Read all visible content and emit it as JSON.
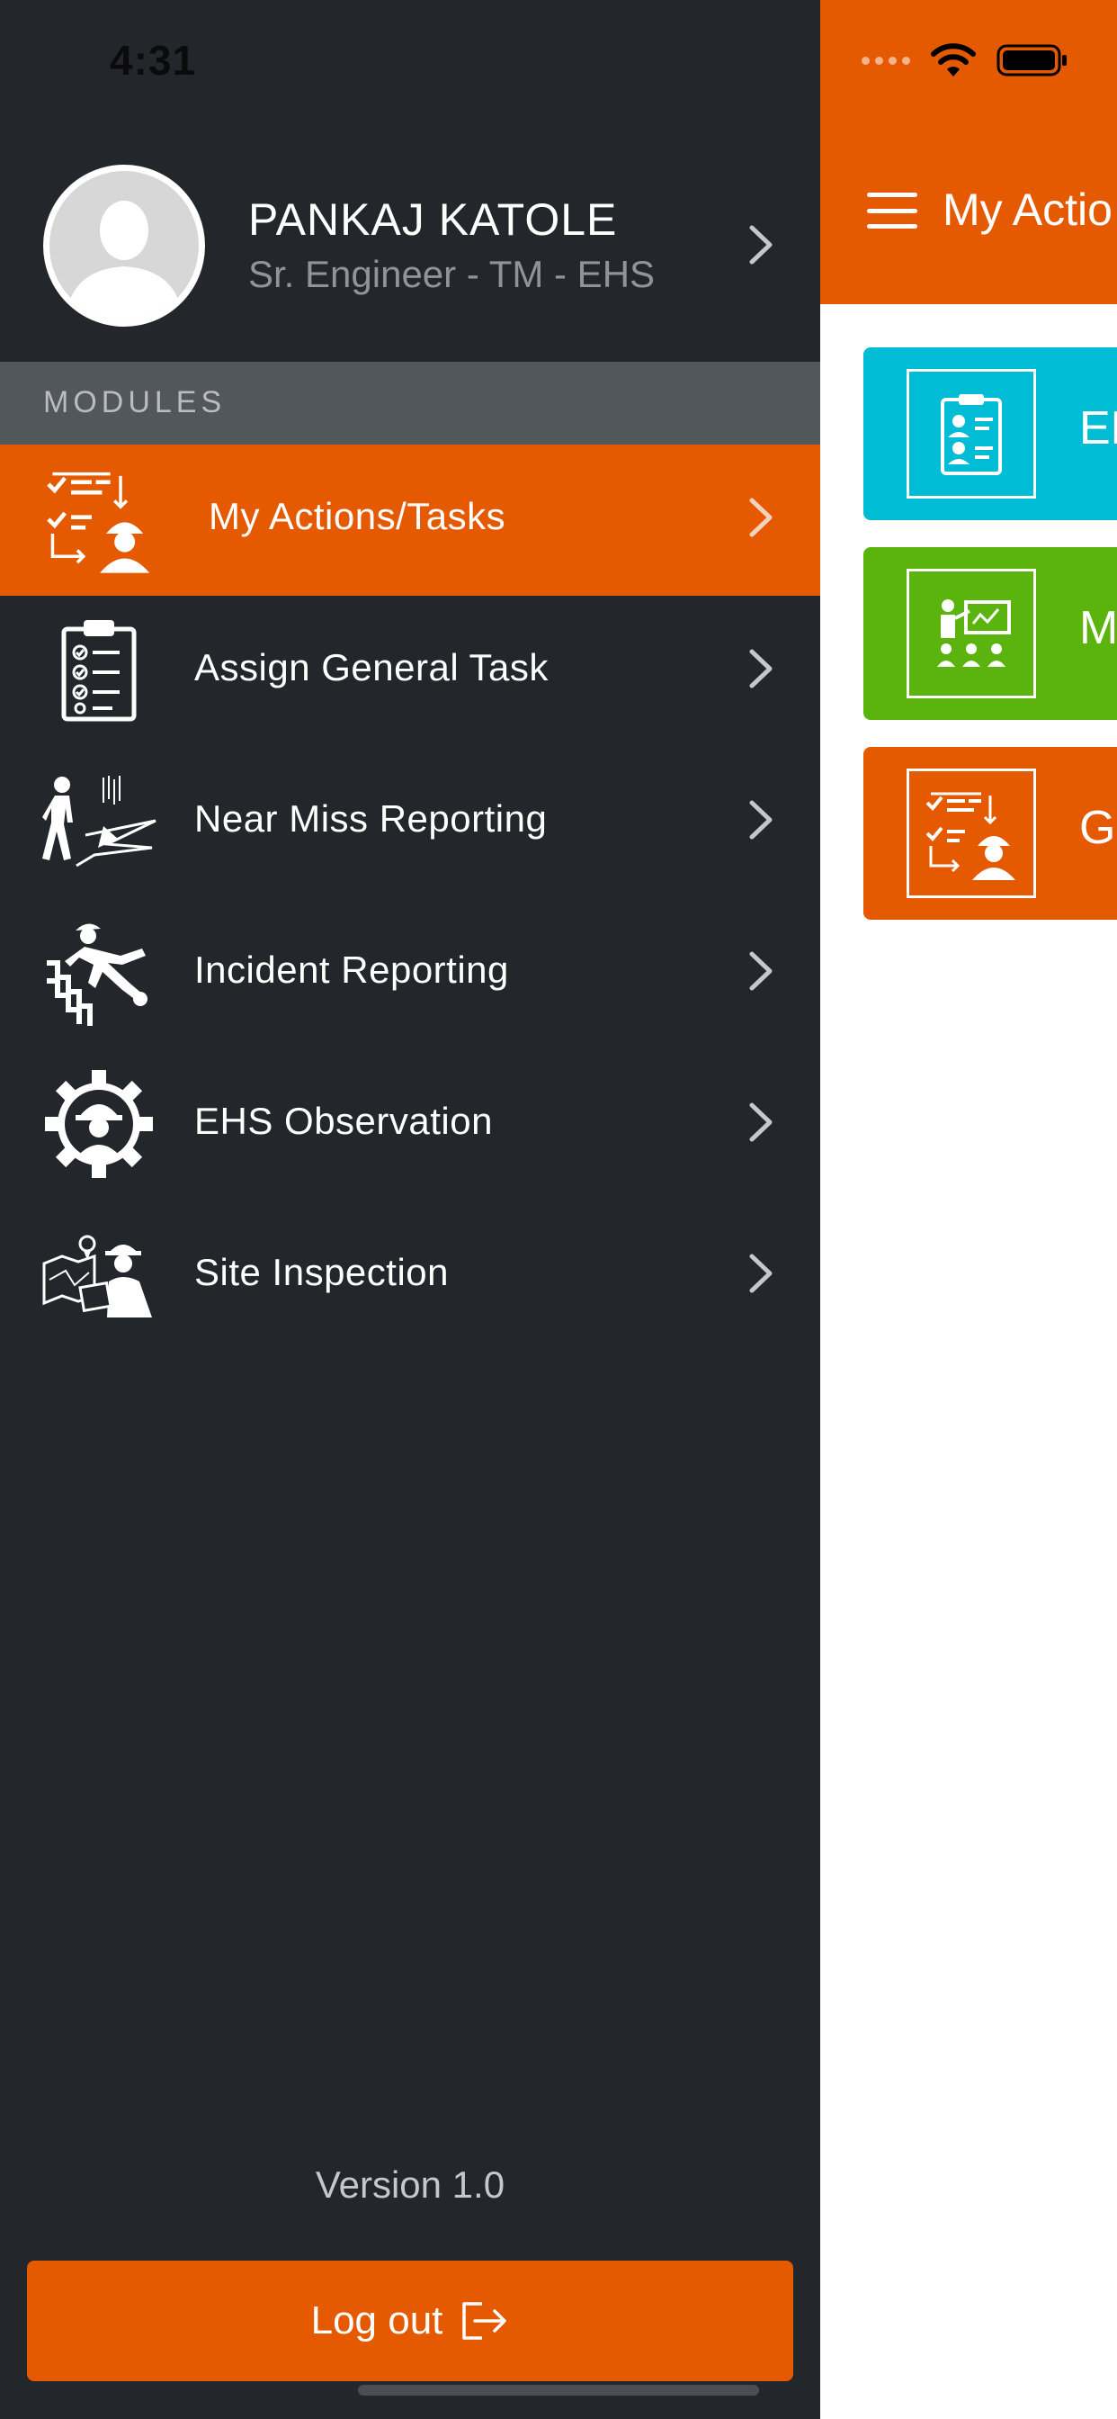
{
  "status_bar": {
    "time": "4:31"
  },
  "profile": {
    "name": "PANKAJ KATOLE",
    "role": "Sr. Engineer - TM - EHS"
  },
  "drawer": {
    "section_title": "MODULES",
    "items": [
      {
        "label": "My Actions/Tasks",
        "icon": "tasks-worker-icon",
        "active": true
      },
      {
        "label": "Assign General Task",
        "icon": "clipboard-checklist-icon",
        "active": false
      },
      {
        "label": "Near Miss Reporting",
        "icon": "near-miss-icon",
        "active": false
      },
      {
        "label": "Incident Reporting",
        "icon": "falling-person-icon",
        "active": false
      },
      {
        "label": "EHS Observation",
        "icon": "gear-helmet-icon",
        "active": false
      },
      {
        "label": "Site Inspection",
        "icon": "site-inspection-icon",
        "active": false
      }
    ],
    "version": "Version 1.0",
    "logout_label": "Log out"
  },
  "main": {
    "title": "My Actio",
    "cards": [
      {
        "label": "EH",
        "color": "#00bcd4",
        "icon": "checklist-people-icon"
      },
      {
        "label": "M",
        "color": "#5bb40d",
        "icon": "training-icon"
      },
      {
        "label": "Ge",
        "color": "#e55a00",
        "icon": "tasks-worker-icon"
      }
    ]
  },
  "colors": {
    "accent": "#e55a00",
    "drawer_bg": "#23262b",
    "section_bg": "#52575c",
    "cyan": "#00bcd4",
    "green": "#5bb40d"
  }
}
